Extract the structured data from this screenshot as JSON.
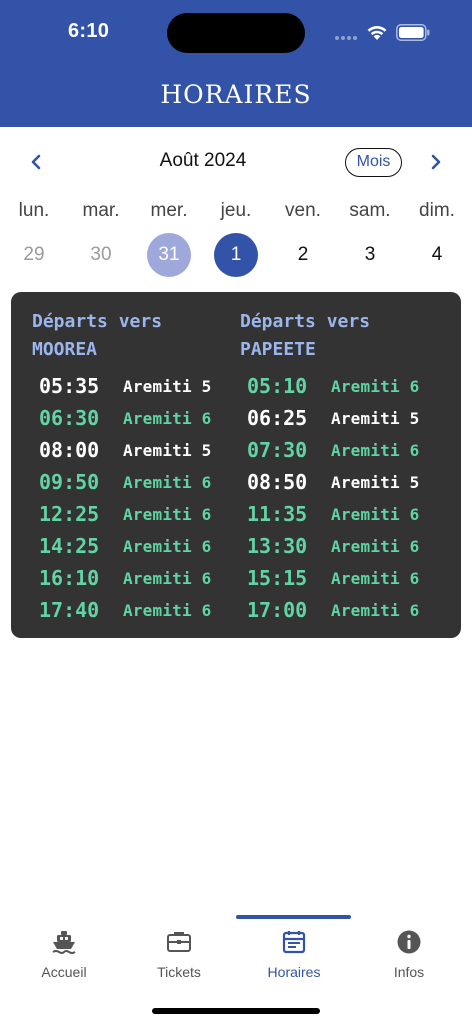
{
  "status_bar": {
    "time": "6:10"
  },
  "header": {
    "title": "HORAIRES"
  },
  "calendar": {
    "month_label": "Août 2024",
    "mois_label": "Mois",
    "days": [
      {
        "weekday": "lun.",
        "number": "29",
        "state": "past"
      },
      {
        "weekday": "mar.",
        "number": "30",
        "state": "past"
      },
      {
        "weekday": "mer.",
        "number": "31",
        "state": "previous-selection"
      },
      {
        "weekday": "jeu.",
        "number": "1",
        "state": "selected"
      },
      {
        "weekday": "ven.",
        "number": "2",
        "state": "normal"
      },
      {
        "weekday": "sam.",
        "number": "3",
        "state": "normal"
      },
      {
        "weekday": "dim.",
        "number": "4",
        "state": "normal"
      }
    ]
  },
  "schedule": {
    "left": {
      "heading_line1": "Départs vers",
      "heading_line2": "MOOREA",
      "departures": [
        {
          "time": "05:35",
          "boat": "Aremiti 5"
        },
        {
          "time": "06:30",
          "boat": "Aremiti 6"
        },
        {
          "time": "08:00",
          "boat": "Aremiti 5"
        },
        {
          "time": "09:50",
          "boat": "Aremiti 6"
        },
        {
          "time": "12:25",
          "boat": "Aremiti 6"
        },
        {
          "time": "14:25",
          "boat": "Aremiti 6"
        },
        {
          "time": "16:10",
          "boat": "Aremiti 6"
        },
        {
          "time": "17:40",
          "boat": "Aremiti 6"
        }
      ]
    },
    "right": {
      "heading_line1": "Départs vers",
      "heading_line2": "PAPEETE",
      "departures": [
        {
          "time": "05:10",
          "boat": "Aremiti 6"
        },
        {
          "time": "06:25",
          "boat": "Aremiti 5"
        },
        {
          "time": "07:30",
          "boat": "Aremiti 6"
        },
        {
          "time": "08:50",
          "boat": "Aremiti 5"
        },
        {
          "time": "11:35",
          "boat": "Aremiti 6"
        },
        {
          "time": "13:30",
          "boat": "Aremiti 6"
        },
        {
          "time": "15:15",
          "boat": "Aremiti 6"
        },
        {
          "time": "17:00",
          "boat": "Aremiti 6"
        }
      ]
    },
    "colors": {
      "board": "#333333",
      "heading": "#9bb6ec",
      "aremiti5": "#ffffff",
      "aremiti6": "#62d3a3"
    }
  },
  "tabbar": {
    "tabs": [
      {
        "label": "Accueil",
        "icon": "ferry-icon"
      },
      {
        "label": "Tickets",
        "icon": "briefcase-icon"
      },
      {
        "label": "Horaires",
        "icon": "calendar-icon",
        "active": true
      },
      {
        "label": "Infos",
        "icon": "info-icon"
      }
    ]
  },
  "colors": {
    "brand": "#3353a8",
    "muted_selection": "#9ea8da"
  }
}
